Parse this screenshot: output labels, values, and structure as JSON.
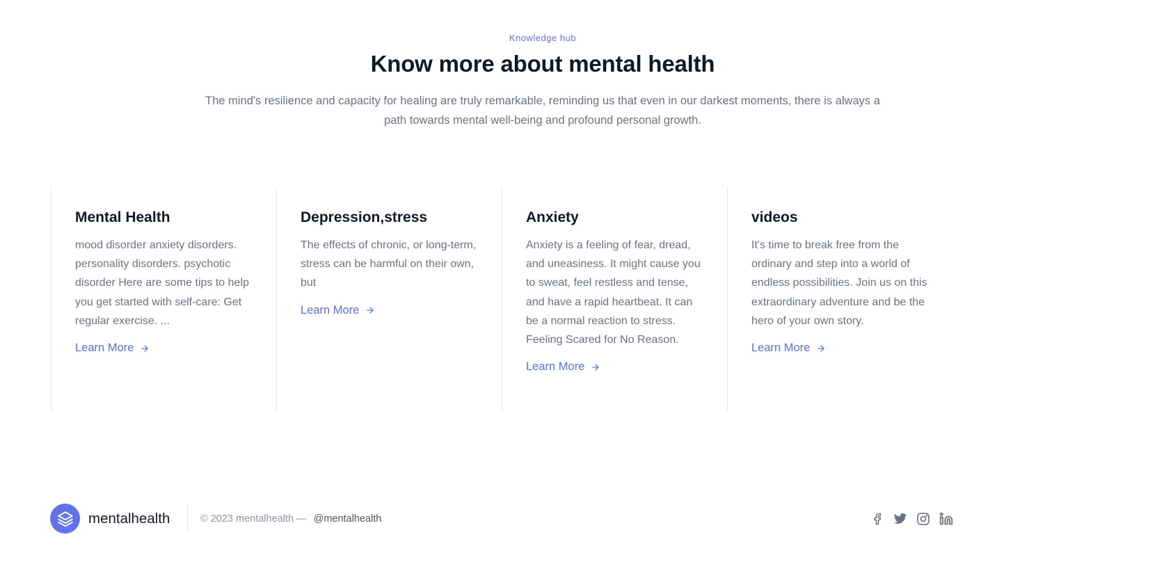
{
  "hero": {
    "eyebrow": "Knowledge hub",
    "title": "Know more about mental health",
    "intro": "The mind's resilience and capacity for healing are truly remarkable, reminding us that even in our darkest moments, there is always a path towards mental well-being and profound personal growth."
  },
  "cards": [
    {
      "title": "Mental Health",
      "text": "mood disorder anxiety disorders. personality disorders. psychotic disorder Here are some tips to help you get started with self-care: Get regular exercise. ...",
      "link": "Learn More"
    },
    {
      "title": "Depression,stress",
      "text": "The effects of chronic, or long-term, stress can be harmful on their own, but",
      "link": "Learn More"
    },
    {
      "title": "Anxiety",
      "text": "Anxiety is a feeling of fear, dread, and uneasiness. It might cause you to sweat, feel restless and tense, and have a rapid heartbeat. It can be a normal reaction to stress. Feeling Scared for No Reason.",
      "link": "Learn More"
    },
    {
      "title": "videos",
      "text": "It's time to break free from the ordinary and step into a world of endless possibilities. Join us on this extraordinary adventure and be the hero of your own story.",
      "link": "Learn More"
    }
  ],
  "footer": {
    "brand": "mentalhealth",
    "copyright": "© 2023 mentalhealth —",
    "handle": "@mentalhealth",
    "logo_icon": "layers-icon",
    "socials": [
      "facebook-icon",
      "twitter-icon",
      "instagram-icon",
      "linkedin-icon"
    ]
  },
  "colors": {
    "accent": "#6372d9",
    "logo_bg": "#6372e9",
    "heading": "#111827",
    "body_text": "#6b7280",
    "divider": "#e5e7eb"
  }
}
